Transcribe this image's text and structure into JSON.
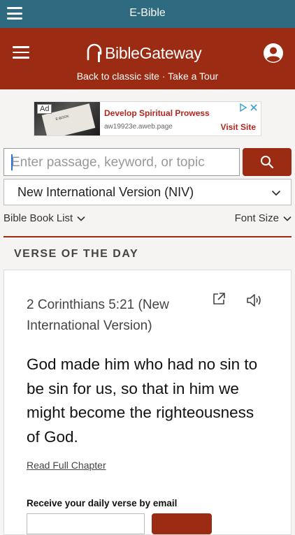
{
  "app": {
    "title": "E-Bible"
  },
  "header": {
    "logo_prefix": "Bible",
    "logo_suffix": "Gateway",
    "link_classic": "Back to classic site",
    "separator": " · ",
    "link_tour": "Take a Tour",
    "bg_color": "#9b2b12"
  },
  "ad": {
    "badge": "Ad",
    "image_caption": "E-BOOK",
    "headline": "Develop Spiritual Prowess",
    "domain": "aw19923e.aweb.page",
    "cta": "Visit Site"
  },
  "search": {
    "placeholder": "Enter passage, keyword, or topic",
    "icon": "search-icon"
  },
  "version": {
    "selected": "New International Version (NIV)"
  },
  "subnav": {
    "book_list": "Bible Book List",
    "font_size": "Font Size"
  },
  "votd": {
    "heading": "VERSE OF THE DAY",
    "reference": "2 Corinthians 5:21 (New International Version)",
    "text": "God made him who had no sin to be sin for us, so that in him we might become the righteousness of God.",
    "read_full": "Read Full Chapter",
    "email_label": "Receive your daily verse by email"
  },
  "colors": {
    "appbar": "#2e6b80",
    "accent": "#9b2b12"
  }
}
